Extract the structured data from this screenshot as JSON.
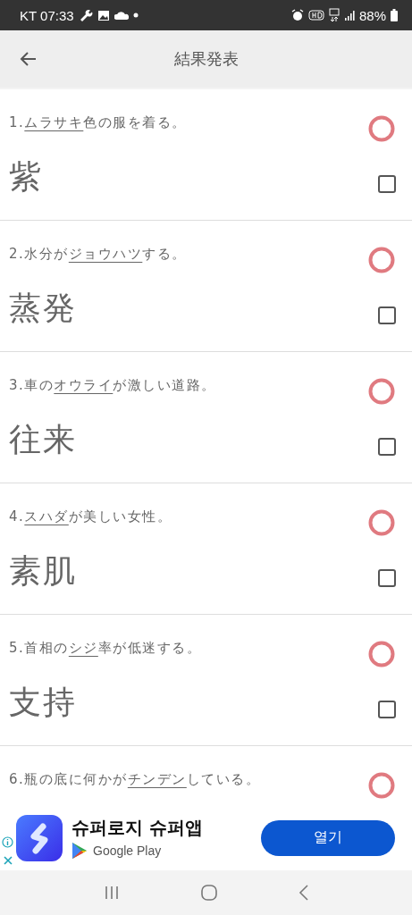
{
  "status_bar": {
    "carrier_time": "KT 07:33",
    "battery": "88%"
  },
  "app_bar": {
    "title": "結果発表"
  },
  "questions": [
    {
      "number": "1.",
      "underlined": "ムラサキ",
      "after": "色の服を着る。",
      "correct": true,
      "answer": "紫",
      "checked": false
    },
    {
      "number": "2.",
      "before": "水分が",
      "underlined": "ジョウハツ",
      "after": "する。",
      "correct": true,
      "answer": "蒸発",
      "checked": false
    },
    {
      "number": "3.",
      "before": "車の",
      "underlined": "オウライ",
      "after": "が激しい道路。",
      "correct": true,
      "answer": "往来",
      "checked": false
    },
    {
      "number": "4.",
      "underlined": "スハダ",
      "after": "が美しい女性。",
      "correct": true,
      "answer": "素肌",
      "checked": false
    },
    {
      "number": "5.",
      "before": "首相の",
      "underlined": "シジ",
      "after": "率が低迷する。",
      "correct": true,
      "answer": "支持",
      "checked": false
    },
    {
      "number": "6.",
      "before": "瓶の底に何かが",
      "underlined": "チンデン",
      "after": "している。",
      "correct": true
    }
  ],
  "ad": {
    "title": "슈퍼로지 슈퍼앱",
    "store": "Google Play",
    "button": "열기"
  }
}
